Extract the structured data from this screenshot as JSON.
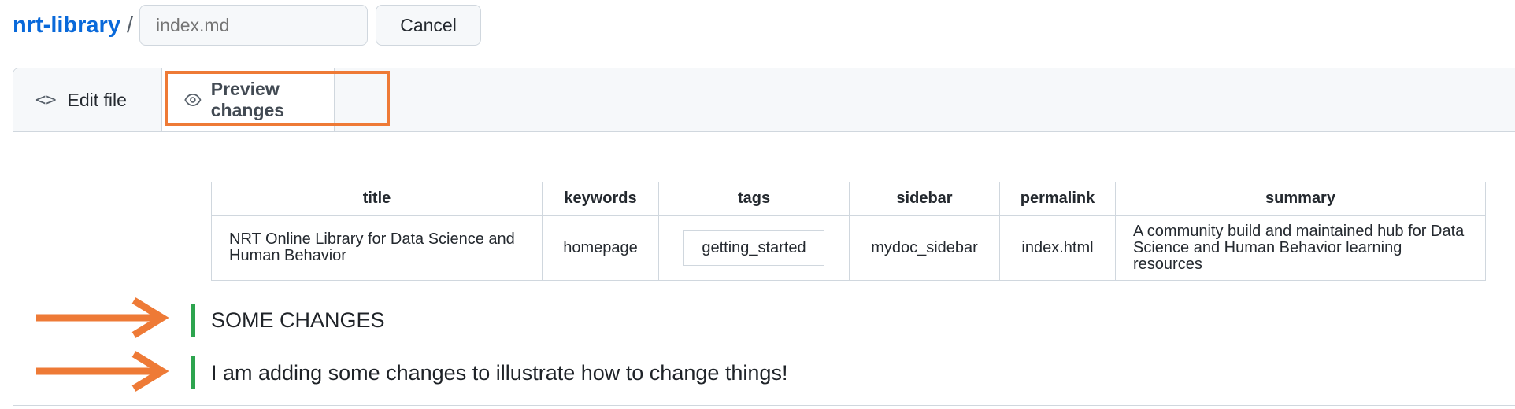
{
  "header": {
    "repo": "nrt-library",
    "separator": "/",
    "filename_placeholder": "index.md",
    "cancel_label": "Cancel"
  },
  "tabs": [
    {
      "label": "Edit file",
      "icon": "code-icon",
      "active": false
    },
    {
      "label": "Preview changes",
      "icon": "eye-icon",
      "active": true
    }
  ],
  "table": {
    "headers": [
      "title",
      "keywords",
      "tags",
      "sidebar",
      "permalink",
      "summary"
    ],
    "row": {
      "title": "NRT Online Library for Data Science and Human Behavior",
      "keywords": "homepage",
      "tags": "getting_started",
      "sidebar": "mydoc_sidebar",
      "permalink": "index.html",
      "summary": "A community build and maintained hub for Data Science and Human Behavior learning resources"
    }
  },
  "added_lines": [
    "SOME CHANGES",
    "I am adding some changes to illustrate how to change things!"
  ],
  "colors": {
    "link": "#0969da",
    "annotation": "#ee7a36",
    "added_bar": "#2da44e",
    "border": "#d0d7de"
  }
}
